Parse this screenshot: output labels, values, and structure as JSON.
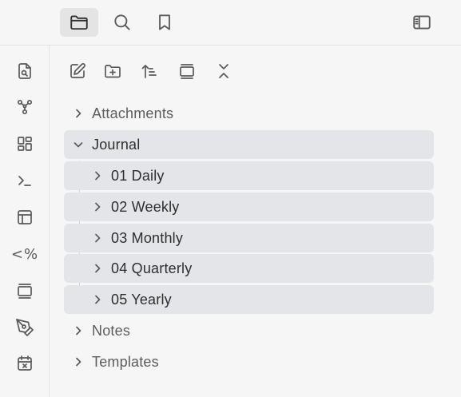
{
  "topbar": {
    "tabs": [
      {
        "icon": "folder-icon",
        "active": true
      },
      {
        "icon": "search-icon",
        "active": false
      },
      {
        "icon": "bookmark-icon",
        "active": false
      }
    ],
    "right_icon": "sidebar-toggle-icon"
  },
  "ribbon": {
    "icons": [
      "file-search-icon",
      "graph-icon",
      "layout-grid-icon",
      "terminal-icon",
      "panel-layout-icon",
      "template-code-icon",
      "card-stack-icon",
      "pen-tool-icon",
      "calendar-x-icon"
    ],
    "template_glyph": "<%"
  },
  "nav_actions": [
    "new-note-icon",
    "new-folder-icon",
    "sort-icon",
    "collapse-view-icon",
    "collapse-all-icon"
  ],
  "tree": {
    "items": [
      {
        "label": "Attachments",
        "level": 0,
        "expanded": false,
        "highlight": false
      },
      {
        "label": "Journal",
        "level": 0,
        "expanded": true,
        "highlight": true
      },
      {
        "label": "01 Daily",
        "level": 1,
        "expanded": false,
        "highlight": true
      },
      {
        "label": "02 Weekly",
        "level": 1,
        "expanded": false,
        "highlight": true
      },
      {
        "label": "03 Monthly",
        "level": 1,
        "expanded": false,
        "highlight": true
      },
      {
        "label": "04 Quarterly",
        "level": 1,
        "expanded": false,
        "highlight": true
      },
      {
        "label": "05 Yearly",
        "level": 1,
        "expanded": false,
        "highlight": true
      },
      {
        "label": "Notes",
        "level": 0,
        "expanded": false,
        "highlight": false
      },
      {
        "label": "Templates",
        "level": 0,
        "expanded": false,
        "highlight": false
      }
    ]
  },
  "colors": {
    "background": "#f6f6f6",
    "highlight": "#e3e5e8",
    "active_tab": "#e4e4e4",
    "text": "#2e2e2e"
  }
}
